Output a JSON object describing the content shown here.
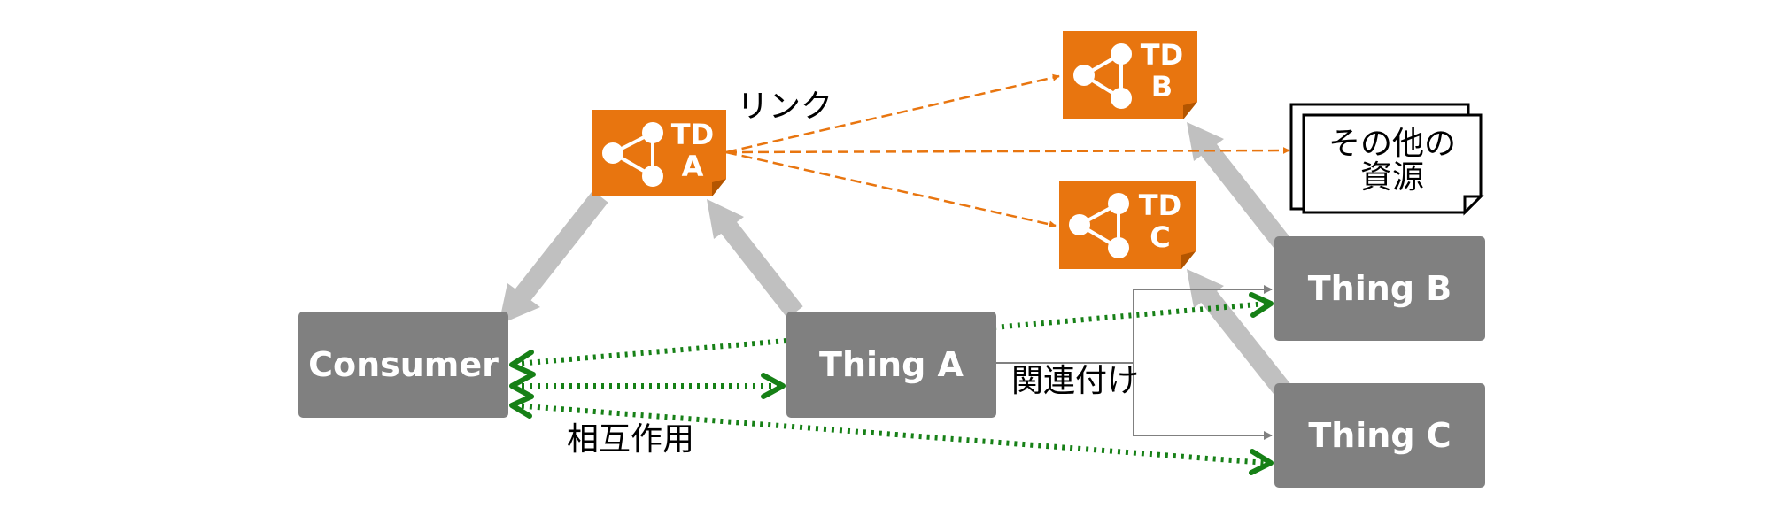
{
  "nodes": {
    "consumer": "Consumer",
    "thing_a": "Thing A",
    "thing_b": "Thing B",
    "thing_c": "Thing C"
  },
  "td_docs": {
    "a": {
      "line1": "TD",
      "line2": "A"
    },
    "b": {
      "line1": "TD",
      "line2": "B"
    },
    "c": {
      "line1": "TD",
      "line2": "C"
    }
  },
  "other_resources": {
    "line1": "その他の",
    "line2": "資源"
  },
  "labels": {
    "link": "リンク",
    "association": "関連付け",
    "interaction": "相互作用"
  },
  "colors": {
    "node_gray": "#808080",
    "td_orange": "#e8750f",
    "td_fold": "#b35500",
    "gray_arrow": "#c0c0c0",
    "dashed_orange": "#e8750f",
    "interaction_green": "#168016",
    "thin_gray": "#808080"
  },
  "icons": {
    "td": "network-graph-icon"
  }
}
